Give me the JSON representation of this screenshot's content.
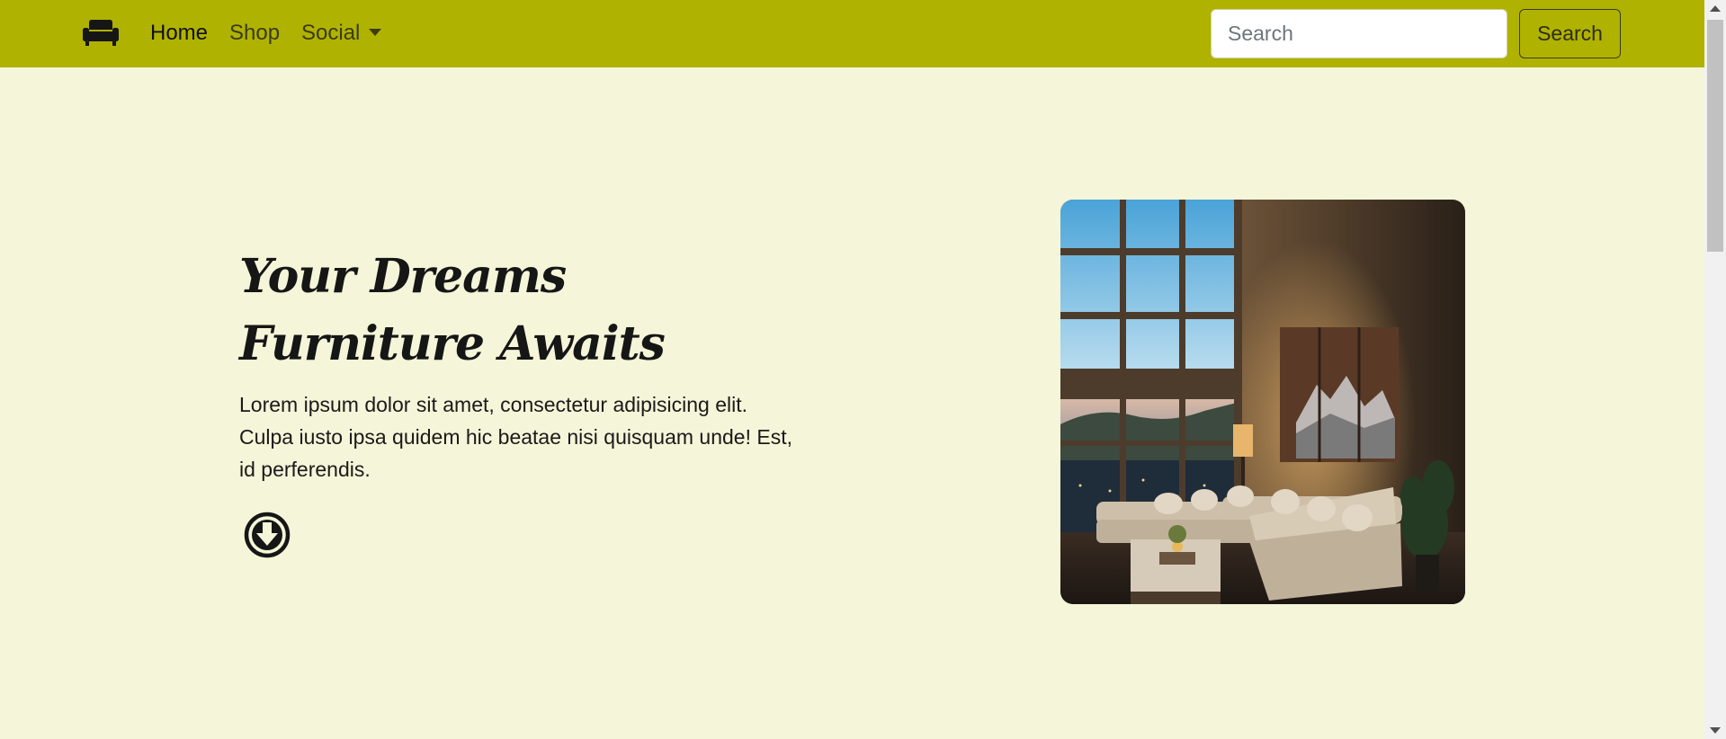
{
  "navbar": {
    "brand_icon": "sofa-icon",
    "items": [
      {
        "label": "Home",
        "active": true
      },
      {
        "label": "Shop",
        "active": false
      },
      {
        "label": "Social",
        "active": false,
        "dropdown": true
      }
    ],
    "search": {
      "placeholder": "Search",
      "value": "",
      "button_label": "Search"
    },
    "color": "#b0b200"
  },
  "hero": {
    "title": "Your Dreams Furniture Awaits",
    "text": "Lorem ipsum dolor sit amet, consectetur adipisicing elit. Culpa iusto ipsa quidem hic beatae nisi quisquam unde! Est, id perferendis.",
    "scroll_icon": "arrow-down-circle-icon",
    "image": "living-room-photo"
  },
  "colors": {
    "background": "#f5f5d9",
    "navbar": "#b0b200",
    "text": "#161616"
  }
}
